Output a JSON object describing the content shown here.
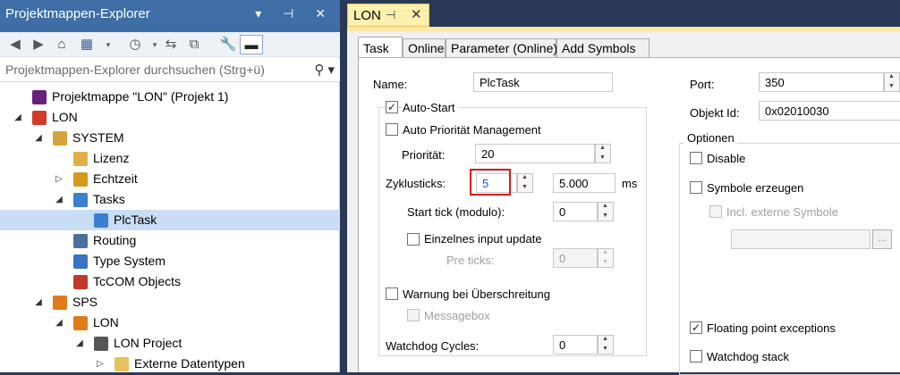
{
  "explorer": {
    "title": "Projektmappen-Explorer",
    "title_controls": "▾ ⊣ ✕",
    "search_placeholder": "Projektmappen-Explorer durchsuchen (Strg+ü)",
    "tree": [
      {
        "label": "Projektmappe \"LON\" (Projekt 1)",
        "icon": "solution-icon",
        "level": 0,
        "expander": ""
      },
      {
        "label": "LON",
        "icon": "twincat-project-icon",
        "level": 0,
        "expander": "◢"
      },
      {
        "label": "SYSTEM",
        "icon": "system-icon",
        "level": 1,
        "expander": "◢"
      },
      {
        "label": "Lizenz",
        "icon": "license-icon",
        "level": 2,
        "expander": ""
      },
      {
        "label": "Echtzeit",
        "icon": "realtime-icon",
        "level": 2,
        "expander": "▷"
      },
      {
        "label": "Tasks",
        "icon": "tasks-icon",
        "level": 2,
        "expander": "◢"
      },
      {
        "label": "PlcTask",
        "icon": "task-icon",
        "level": 3,
        "expander": "",
        "selected": true
      },
      {
        "label": "Routing",
        "icon": "routing-icon",
        "level": 2,
        "expander": ""
      },
      {
        "label": "Type System",
        "icon": "type-system-icon",
        "level": 2,
        "expander": ""
      },
      {
        "label": "TcCOM Objects",
        "icon": "tccom-icon",
        "level": 2,
        "expander": ""
      },
      {
        "label": "SPS",
        "icon": "plc-icon",
        "level": 1,
        "expander": "◢"
      },
      {
        "label": "LON",
        "icon": "plc-project-icon",
        "level": 2,
        "expander": "◢"
      },
      {
        "label": "LON Project",
        "icon": "plc-subproject-icon",
        "level": 3,
        "expander": "◢"
      },
      {
        "label": "Externe Datentypen",
        "icon": "folder-icon",
        "level": 4,
        "expander": "▷"
      }
    ]
  },
  "editor": {
    "tab_title": "LON",
    "tabs": [
      "Task",
      "Online",
      "Parameter (Online)",
      "Add Symbols"
    ],
    "name_label": "Name:",
    "name_value": "PlcTask",
    "auto_start_label": "Auto-Start",
    "auto_prio_label": "Auto Priorität Management",
    "priority_label": "Priorität:",
    "priority_value": "20",
    "cycle_label": "Zyklusticks:",
    "cycle_value": "5",
    "cycle_ms_value": "5.000",
    "ms_label": "ms",
    "start_tick_label": "Start tick (modulo):",
    "start_tick_value": "0",
    "single_input_label": "Einzelnes input update",
    "pre_ticks_label": "Pre ticks:",
    "pre_ticks_value": "0",
    "warn_label": "Warnung bei Überschreitung",
    "messagebox_label": "Messagebox",
    "watchdog_label": "Watchdog Cycles:",
    "watchdog_value": "0",
    "port_label": "Port:",
    "port_value": "350",
    "object_id_label": "Objekt Id:",
    "object_id_value": "0x02010030",
    "options_label": "Optionen",
    "disable_label": "Disable",
    "symbols_label": "Symbole erzeugen",
    "ext_symbols_label": "Incl. externe Symbole",
    "browse_label": "...",
    "fpe_label": "Floating point exceptions",
    "wd_stack_label": "Watchdog stack",
    "check_mark": "✓"
  }
}
